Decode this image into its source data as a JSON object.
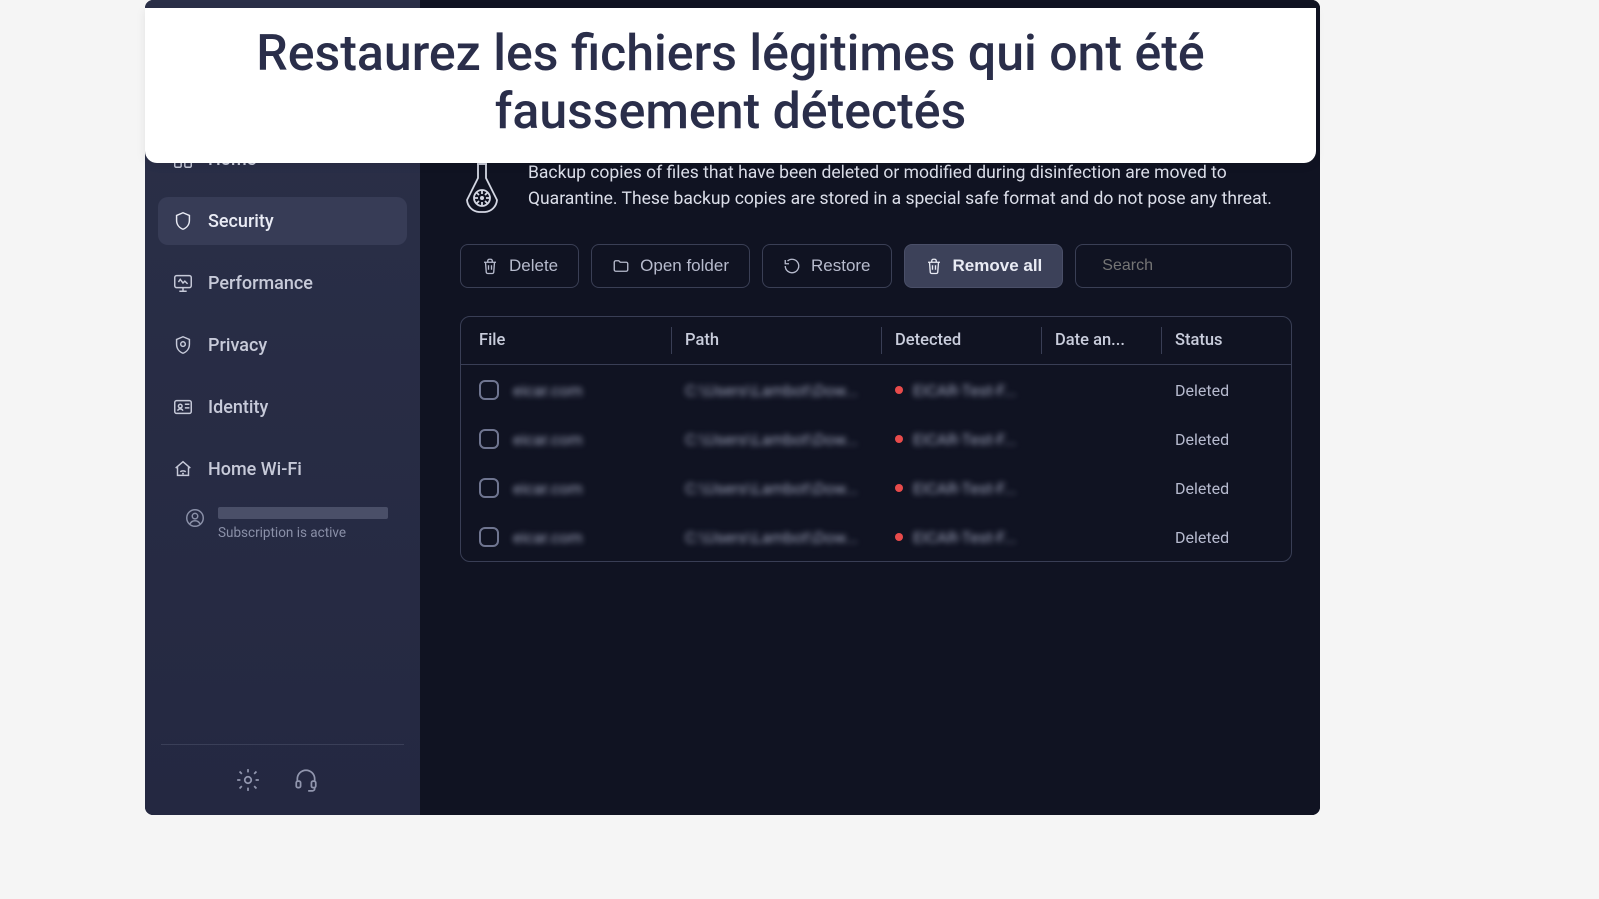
{
  "banner": {
    "title": "Restaurez les fichiers légitimes qui ont été faussement détectés"
  },
  "sidebar": {
    "items": [
      {
        "label": "Home"
      },
      {
        "label": "Security"
      },
      {
        "label": "Performance"
      },
      {
        "label": "Privacy"
      },
      {
        "label": "Identity"
      },
      {
        "label": "Home Wi-Fi"
      }
    ],
    "subscription_status": "Subscription is active"
  },
  "main": {
    "info_text": "Backup copies of files that have been deleted or modified during disinfection are moved to Quarantine. These backup copies are stored in a special safe format and do not pose any threat.",
    "toolbar": {
      "delete": "Delete",
      "open_folder": "Open folder",
      "restore": "Restore",
      "remove_all": "Remove all"
    },
    "search_placeholder": "Search",
    "columns": {
      "file": "File",
      "path": "Path",
      "detected": "Detected",
      "date": "Date an...",
      "status": "Status"
    },
    "rows": [
      {
        "file": "eicar.com",
        "path": "C:\\Users\\Lambot\\Dow...",
        "detected": "EICAR-Test-F...",
        "date": "",
        "status": "Deleted"
      },
      {
        "file": "eicar.com",
        "path": "C:\\Users\\Lambot\\Dow...",
        "detected": "EICAR-Test-F...",
        "date": "",
        "status": "Deleted"
      },
      {
        "file": "eicar.com",
        "path": "C:\\Users\\Lambot\\Dow...",
        "detected": "EICAR-Test-F...",
        "date": "",
        "status": "Deleted"
      },
      {
        "file": "eicar.com",
        "path": "C:\\Users\\Lambot\\Dow...",
        "detected": "EICAR-Test-F...",
        "date": "",
        "status": "Deleted"
      }
    ]
  }
}
